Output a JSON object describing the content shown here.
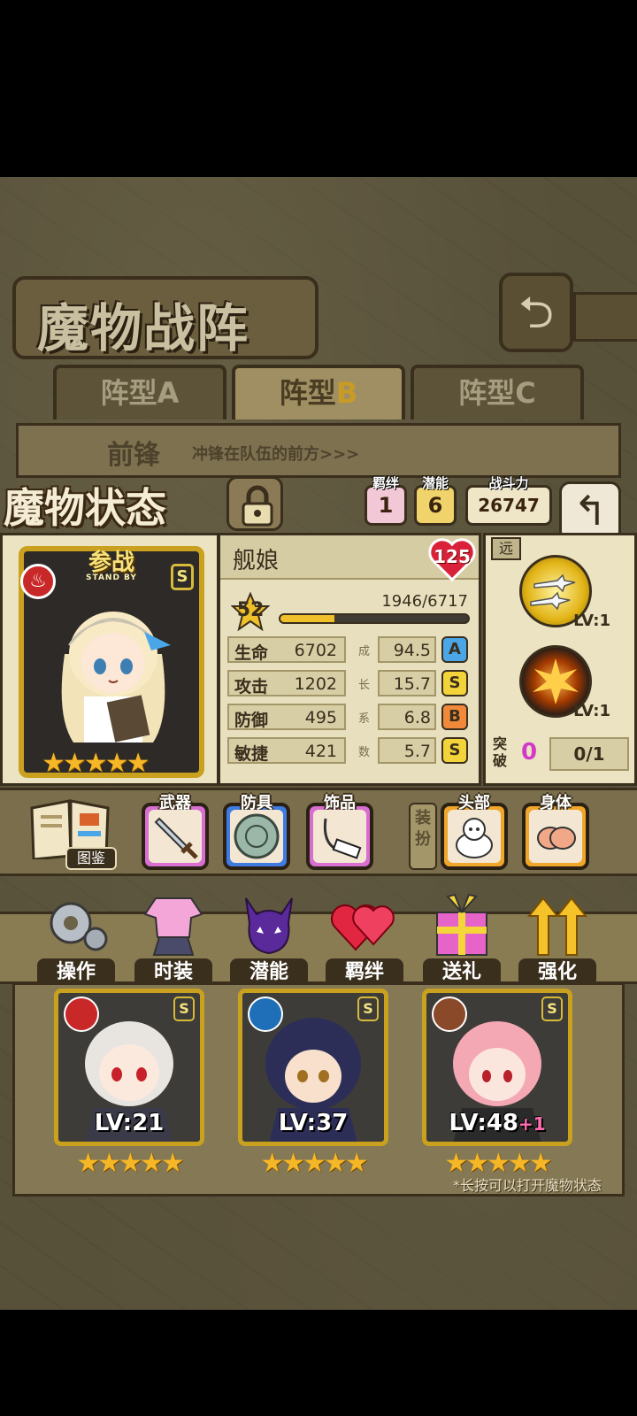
{
  "header": {
    "title": "魔物战阵",
    "back_icon": "return-icon"
  },
  "tabs": [
    {
      "label": "阵型",
      "letter": "A",
      "active": false
    },
    {
      "label": "阵型",
      "letter": "B",
      "active": true
    },
    {
      "label": "阵型",
      "letter": "C",
      "active": false
    }
  ],
  "formation": {
    "position": "前锋",
    "description": "冲锋在队伍的前方>>>"
  },
  "status": {
    "title": "魔物状态",
    "bond_label": "羁绊",
    "bond_value": "1",
    "potential_label": "潜能",
    "potential_value": "6",
    "power_label": "战斗力",
    "power_value": "26747"
  },
  "character": {
    "name": "舰娘",
    "standby": "参战",
    "standby_en": "STAND BY",
    "rank": "S",
    "stars": "★★★★★",
    "star_count": 5,
    "affection": "125",
    "level": "52",
    "exp": "1946/6717",
    "exp_fraction": 0.29,
    "element_color": "#c82828",
    "stats": [
      {
        "name": "生命",
        "value": "6702",
        "growth": "94.5",
        "grade": "A",
        "grade_color": "#4aa6e6"
      },
      {
        "name": "攻击",
        "value": "1202",
        "growth": "15.7",
        "grade": "S",
        "grade_color": "#f2d43a"
      },
      {
        "name": "防御",
        "value": "495",
        "growth": "6.8",
        "grade": "B",
        "grade_color": "#f08a3a"
      },
      {
        "name": "敏捷",
        "value": "421",
        "growth": "5.7",
        "grade": "S",
        "grade_color": "#f2d43a"
      }
    ],
    "growth_label": [
      "成",
      "长",
      "系",
      "数"
    ]
  },
  "skills": {
    "range": "远",
    "items": [
      {
        "name": "aircraft-skill-icon",
        "level": "LV:1"
      },
      {
        "name": "explosion-skill-icon",
        "level": "LV:1"
      }
    ],
    "breakthrough_label": "突破",
    "breakthrough_value": "0",
    "breakthrough_progress": "0/1"
  },
  "equipment": {
    "book_label": "图鉴",
    "weapon_label": "武器",
    "armor_label": "防具",
    "accessory_label": "饰品",
    "dress_label": "装扮",
    "head_label": "头部",
    "body_label": "身体"
  },
  "menu": [
    {
      "label": "操作",
      "icon": "gear-icon"
    },
    {
      "label": "时装",
      "icon": "outfit-icon"
    },
    {
      "label": "潜能",
      "icon": "demon-icon"
    },
    {
      "label": "羁绊",
      "icon": "hearts-icon"
    },
    {
      "label": "送礼",
      "icon": "gift-icon"
    },
    {
      "label": "强化",
      "icon": "upgrade-arrows-icon"
    }
  ],
  "roster": [
    {
      "level": "LV:21",
      "plus": "",
      "rank": "S",
      "element_color": "#c82828",
      "stars": "★★★★★",
      "star_count": 5
    },
    {
      "level": "LV:37",
      "plus": "",
      "rank": "S",
      "element_color": "#1e6fb8",
      "stars": "★★★★★",
      "star_count": 5
    },
    {
      "level": "LV:48",
      "plus": "+1",
      "rank": "S",
      "element_color": "#8a4a2a",
      "stars": "★★★★★",
      "star_count": 5
    }
  ],
  "hint": "*长按可以打开魔物状态"
}
